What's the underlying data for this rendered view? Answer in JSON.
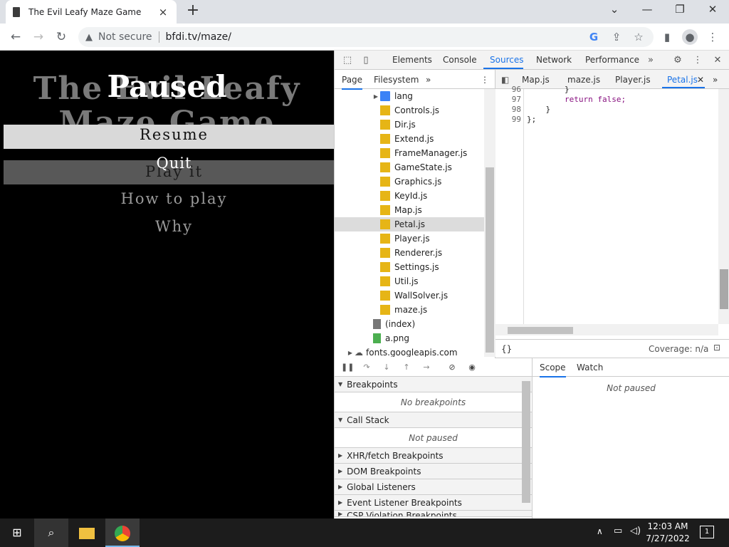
{
  "browser": {
    "tab_title": "The Evil Leafy Maze Game",
    "tab_close": "×",
    "new_tab": "+",
    "security_label": "Not secure",
    "url": "bfdi.tv/maze/"
  },
  "game": {
    "title_line1": "The Evil Leafy",
    "title_line2": "Maze Game",
    "paused": "Paused",
    "resume": "Resume",
    "quit": "Quit",
    "play_it": "Play it",
    "how_to_play": "How to play",
    "why": "Why"
  },
  "devtools": {
    "tabs": [
      "Elements",
      "Console",
      "Sources",
      "Network",
      "Performance"
    ],
    "active_tab": "Sources",
    "navigator_tabs": [
      "Page",
      "Filesystem"
    ],
    "files": [
      {
        "name": "lang",
        "kind": "folder"
      },
      {
        "name": "Controls.js",
        "kind": "js"
      },
      {
        "name": "Dir.js",
        "kind": "js"
      },
      {
        "name": "Extend.js",
        "kind": "js"
      },
      {
        "name": "FrameManager.js",
        "kind": "js"
      },
      {
        "name": "GameState.js",
        "kind": "js"
      },
      {
        "name": "Graphics.js",
        "kind": "js"
      },
      {
        "name": "KeyId.js",
        "kind": "js"
      },
      {
        "name": "Map.js",
        "kind": "js"
      },
      {
        "name": "Petal.js",
        "kind": "js"
      },
      {
        "name": "Player.js",
        "kind": "js"
      },
      {
        "name": "Renderer.js",
        "kind": "js"
      },
      {
        "name": "Settings.js",
        "kind": "js"
      },
      {
        "name": "Util.js",
        "kind": "js"
      },
      {
        "name": "WallSolver.js",
        "kind": "js"
      },
      {
        "name": "maze.js",
        "kind": "js"
      },
      {
        "name": "(index)",
        "kind": "doc"
      },
      {
        "name": "a.png",
        "kind": "img"
      },
      {
        "name": "fonts.googleapis.com",
        "kind": "cloud"
      }
    ],
    "selected_file": "Petal.js",
    "editor_tabs": [
      "Map.js",
      "maze.js",
      "Player.js",
      "Petal.js"
    ],
    "active_editor_tab": "Petal.js",
    "code_lines": [
      {
        "num": "96",
        "text": "        }"
      },
      {
        "num": "97",
        "text": "        return false;"
      },
      {
        "num": "98",
        "text": "    }"
      },
      {
        "num": "99",
        "text": "};"
      }
    ],
    "pretty_print": "{}",
    "coverage": "Coverage: n/a",
    "breakpoints_label": "Breakpoints",
    "no_breakpoints": "No breakpoints",
    "call_stack_label": "Call Stack",
    "call_stack_status": "Not paused",
    "collapsed_sections": [
      "XHR/fetch Breakpoints",
      "DOM Breakpoints",
      "Global Listeners",
      "Event Listener Breakpoints",
      "CSP Violation Breakpoints"
    ],
    "scope_tabs": [
      "Scope",
      "Watch"
    ],
    "scope_status": "Not paused"
  },
  "taskbar": {
    "time": "12:03 AM",
    "date": "7/27/2022",
    "notifications": "1"
  }
}
